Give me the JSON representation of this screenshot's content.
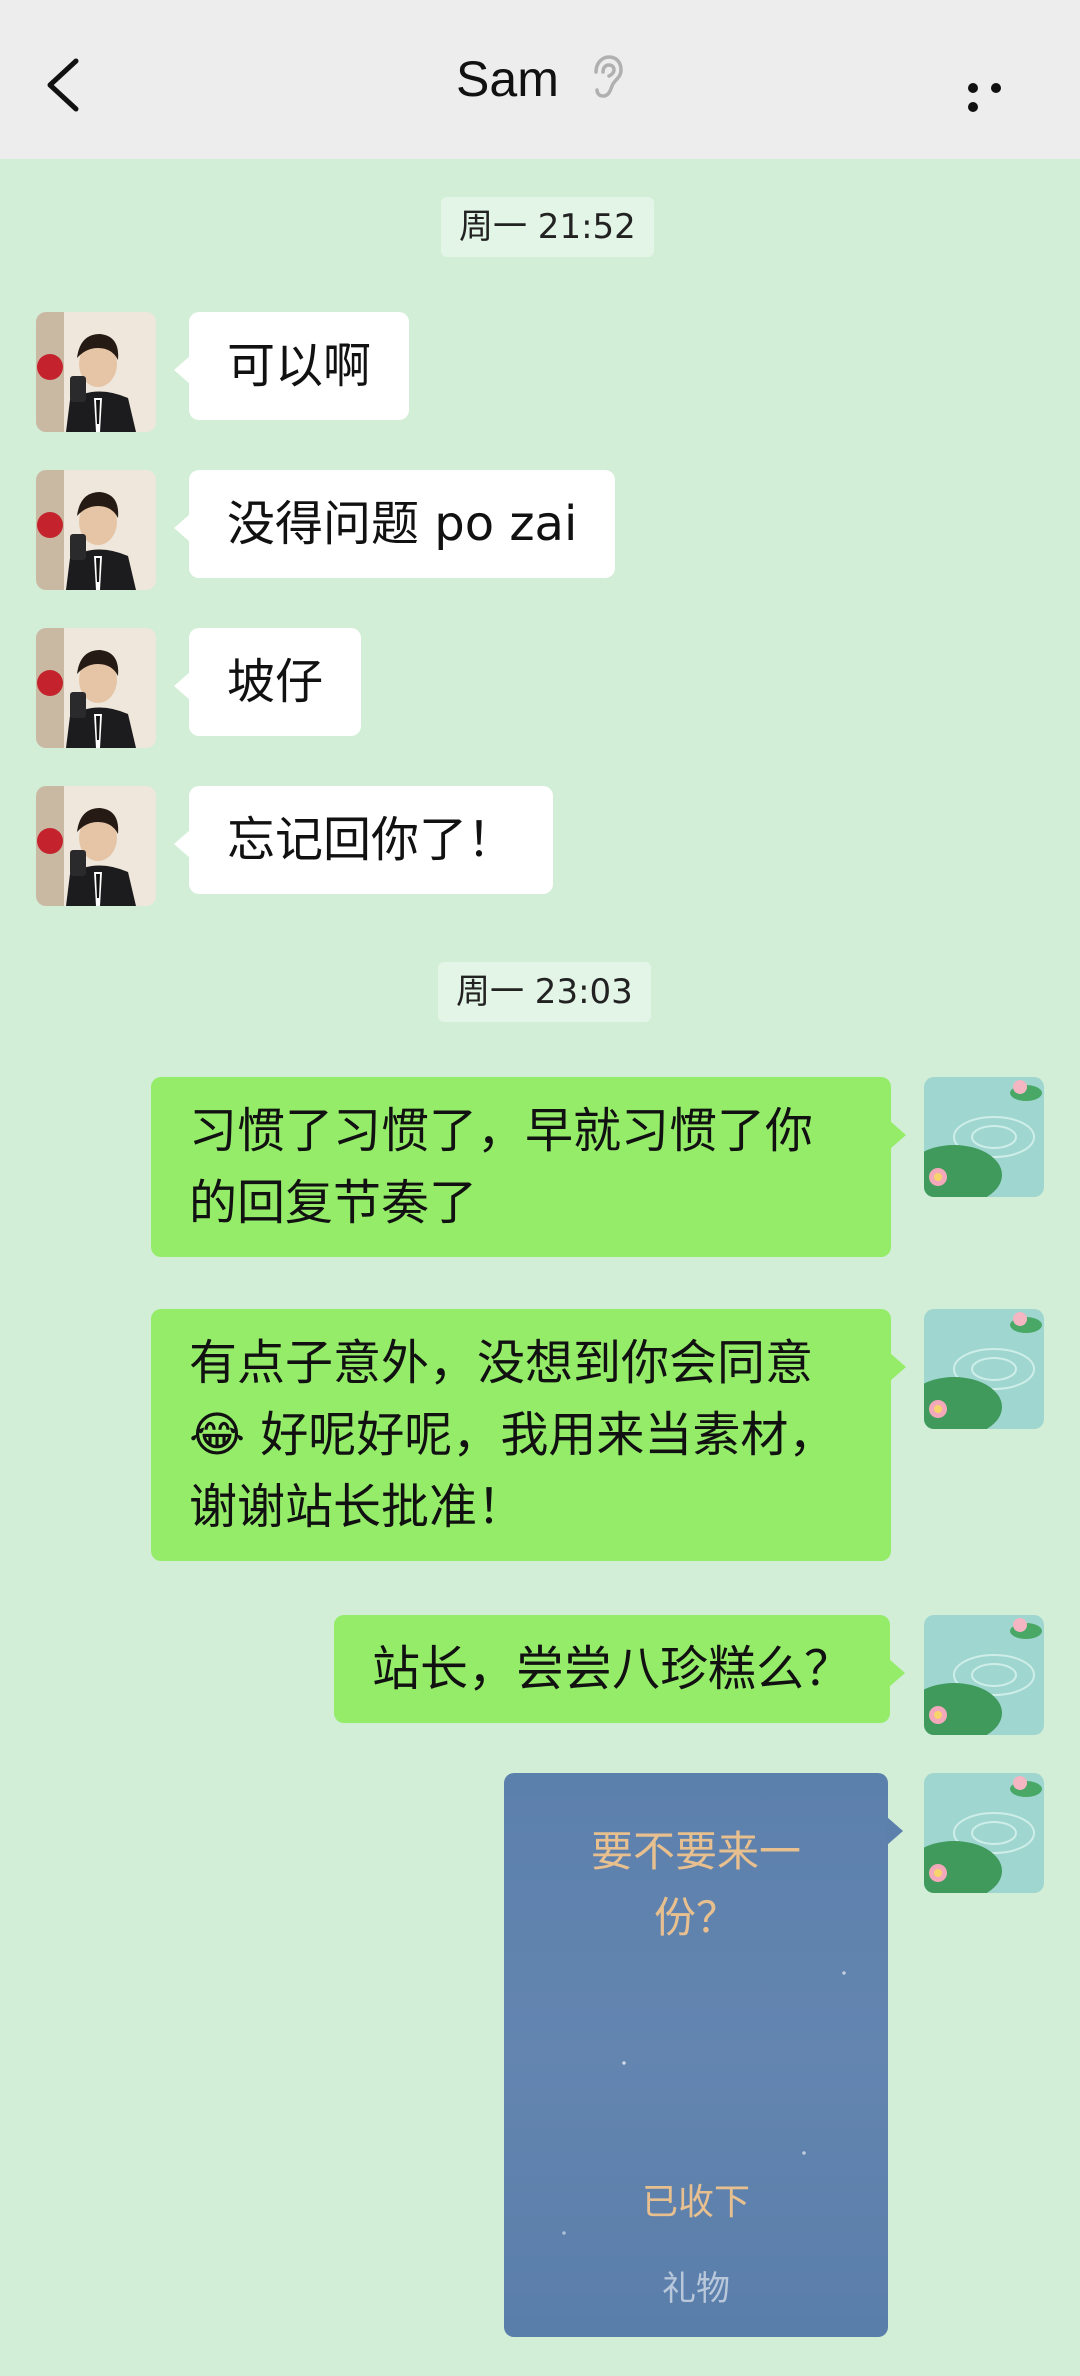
{
  "header": {
    "title": "Sam",
    "back_icon": "chevron-left-icon",
    "mode_icon": "ear-icon",
    "more_icon": "more-dots-icon"
  },
  "timestamps": [
    "周一 21:52",
    "周一 23:03"
  ],
  "messages_received": [
    {
      "text": "可以啊"
    },
    {
      "text": "没得问题 po zai"
    },
    {
      "text": "坡仔"
    },
    {
      "text": "忘记回你了！"
    }
  ],
  "messages_sent": [
    {
      "text": "习惯了习惯了，早就习惯了你的回复节奏了"
    },
    {
      "text_before": "有点子意外，没想到你会同意",
      "emoji": "😂",
      "text_after": " 好呢好呢，我用来当素材，谢谢站长批准！"
    },
    {
      "text": "站长，尝尝八珍糕么？"
    }
  ],
  "gift": {
    "message": "要不要来一份？",
    "status": "已收下",
    "label": "礼物"
  },
  "colors": {
    "chat_background": "#d2eed6",
    "header_background": "#ededed",
    "bubble_in": "#ffffff",
    "bubble_out": "#95ec69",
    "gift_card": "#5e82ad",
    "gift_text": "#e8c08f"
  }
}
